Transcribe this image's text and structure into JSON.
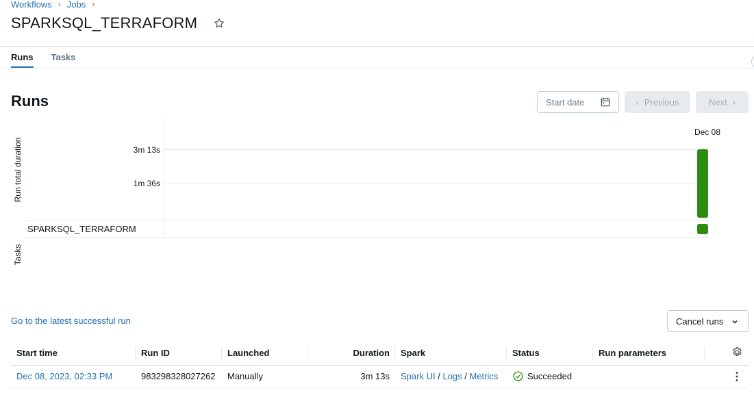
{
  "breadcrumb": {
    "items": [
      "Workflows",
      "Jobs"
    ]
  },
  "page": {
    "title": "SPARKSQL_TERRAFORM"
  },
  "tabs": [
    {
      "label": "Runs",
      "active": true
    },
    {
      "label": "Tasks",
      "active": false
    }
  ],
  "runs_section": {
    "heading": "Runs",
    "start_date_placeholder": "Start date",
    "previous_label": "Previous",
    "next_label": "Next"
  },
  "chart_data": {
    "type": "bar",
    "ylabel": "Run total duration",
    "yticks": [
      "3m 13s",
      "1m 36s"
    ],
    "categories": [
      "Dec 08"
    ],
    "series": [
      {
        "values": [
          193
        ]
      }
    ],
    "task_rows": [
      {
        "name": "SPARKSQL_TERRAFORM",
        "status": "succeeded"
      }
    ],
    "tasks_label": "Tasks",
    "bar_color": "#2e8b12"
  },
  "actions": {
    "latest_successful_link": "Go to the latest successful run",
    "cancel_runs_label": "Cancel runs"
  },
  "table": {
    "columns": [
      "Start time",
      "Run ID",
      "Launched",
      "Duration",
      "Spark",
      "Status",
      "Run parameters"
    ],
    "rows": [
      {
        "start_time": "Dec 08, 2023, 02:33 PM",
        "run_id": "983298328027262",
        "launched": "Manually",
        "duration": "3m 13s",
        "spark_ui": "Spark UI",
        "logs": "Logs",
        "metrics": "Metrics",
        "status": "Succeeded"
      }
    ]
  },
  "colors": {
    "accent": "#2272b4",
    "success": "#2e8b12"
  }
}
